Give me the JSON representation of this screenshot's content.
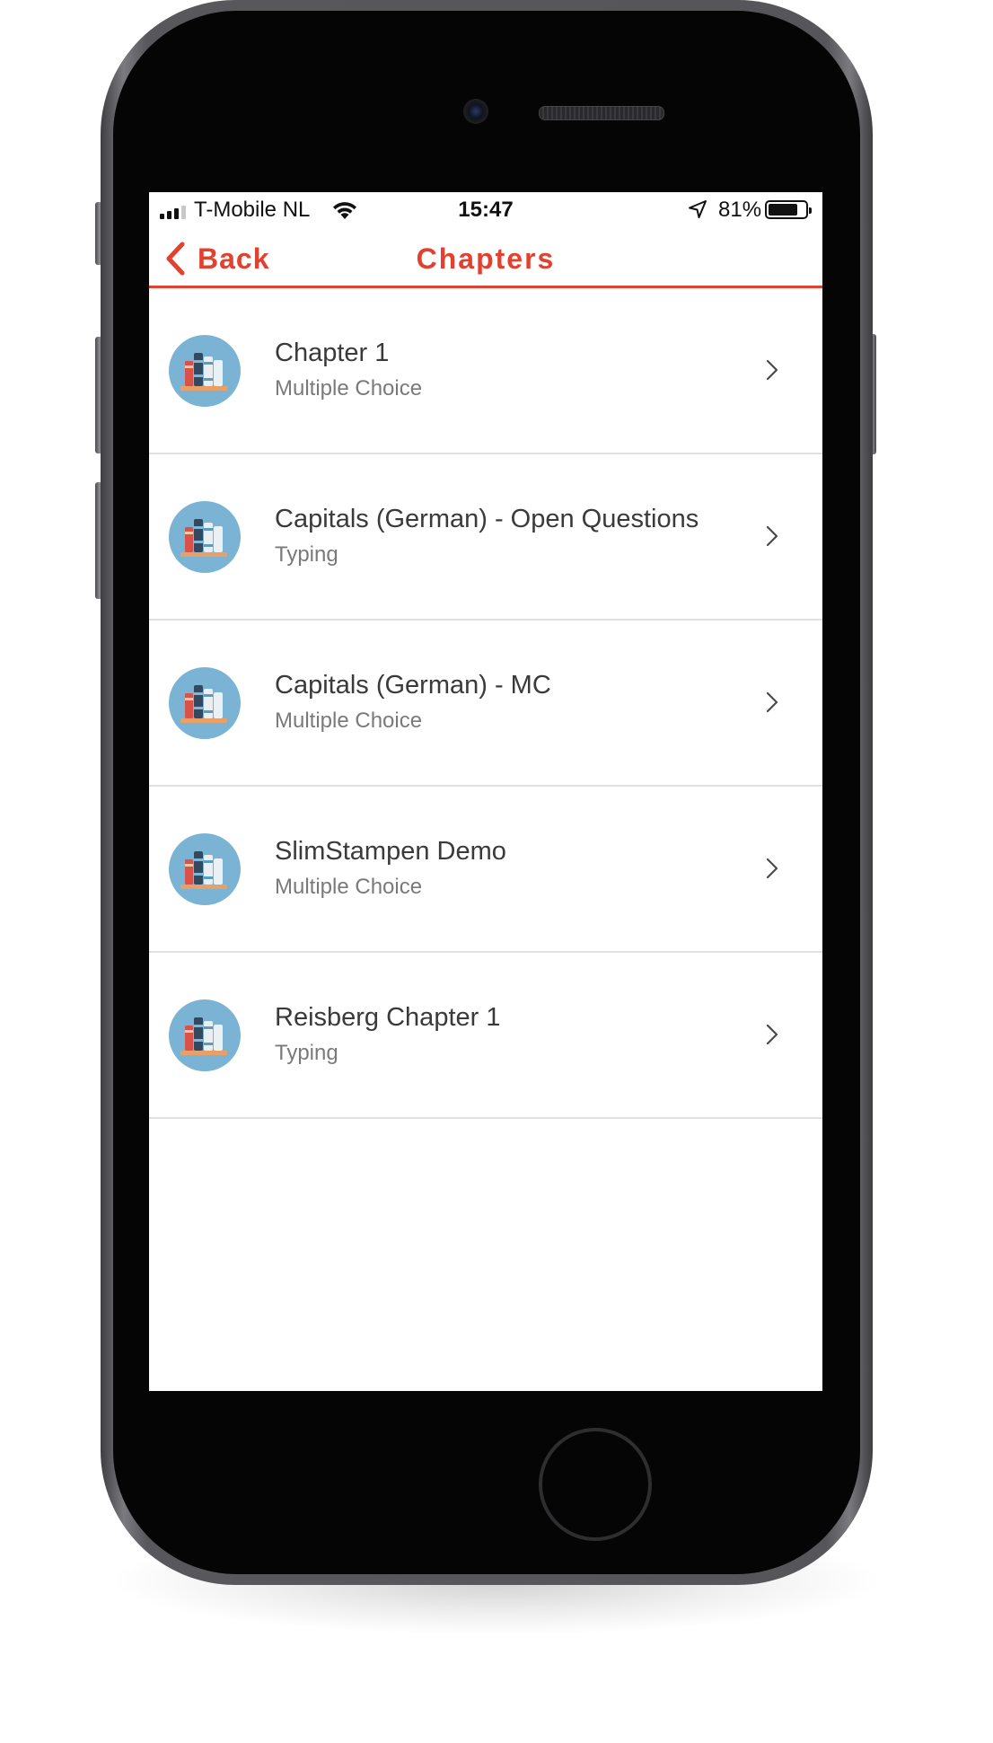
{
  "status_bar": {
    "carrier": "T-Mobile NL",
    "time": "15:47",
    "battery_percent": "81%",
    "battery_level": 0.81,
    "signal_bars_filled": 3,
    "signal_bars_total": 4,
    "wifi_icon": "wifi-icon",
    "location_icon": "location-arrow-icon"
  },
  "nav": {
    "back_label": "Back",
    "title": "Chapters",
    "back_icon": "chevron-left-icon"
  },
  "chapters": [
    {
      "title": "Chapter 1",
      "mode": "Multiple Choice"
    },
    {
      "title": "Capitals (German) - Open Questions",
      "mode": "Typing"
    },
    {
      "title": "Capitals (German) - MC",
      "mode": "Multiple Choice"
    },
    {
      "title": "SlimStampen Demo",
      "mode": "Multiple Choice"
    },
    {
      "title": "Reisberg Chapter 1",
      "mode": "Typing"
    }
  ],
  "colors": {
    "accent": "#e2412f",
    "icon_circle": "#7ab3d4",
    "divider": "#e1e1e1",
    "title_text": "#3a3a3a",
    "subtitle_text": "#7a7a7a"
  }
}
